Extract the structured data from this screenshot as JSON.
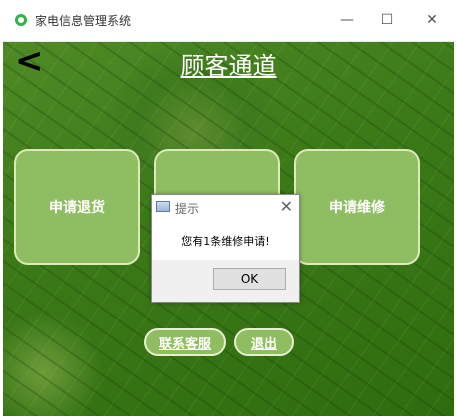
{
  "window": {
    "title": "家电信息管理系统",
    "minimize_glyph": "—",
    "maximize_glyph": "☐",
    "close_glyph": "✕"
  },
  "page": {
    "back_glyph": "<",
    "title": "顾客通道",
    "tiles": [
      "申请退货",
      "",
      "申请维修"
    ],
    "bottom_buttons": {
      "contact": "联系客服",
      "exit": "退出"
    }
  },
  "dialog": {
    "title": "提示",
    "close_glyph": "✕",
    "message": "您有1条维修申请!",
    "ok_label": "OK"
  },
  "colors": {
    "tile_fill": "#8fbd61",
    "background_green": "#3c7a18"
  }
}
